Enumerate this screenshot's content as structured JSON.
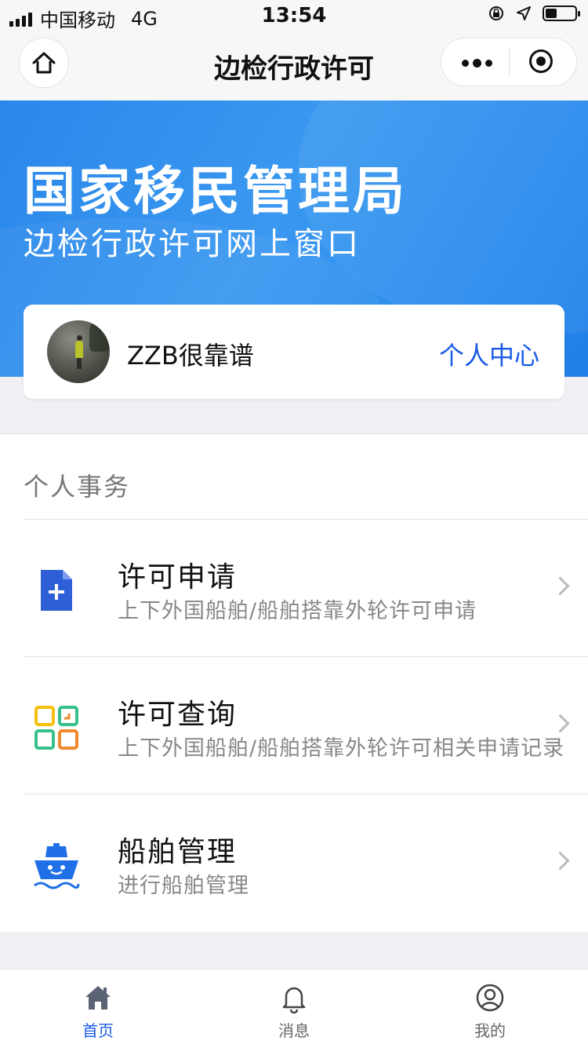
{
  "status_bar": {
    "carrier": "中国移动",
    "network": "4G",
    "time": "13:54"
  },
  "nav": {
    "title": "边检行政许可",
    "home_icon": "home-icon",
    "more_icon": "more-icon",
    "close_icon": "target-icon"
  },
  "banner": {
    "title": "国家移民管理局",
    "subtitle": "边检行政许可网上窗口"
  },
  "user": {
    "name": "ZZB很靠谱",
    "center_link": "个人中心"
  },
  "section": {
    "title": "个人事务",
    "items": [
      {
        "title": "许可申请",
        "desc": "上下外国船舶/船舶搭靠外轮许可申请",
        "icon": "add-document-icon"
      },
      {
        "title": "许可查询",
        "desc": "上下外国船舶/船舶搭靠外轮许可相关申请记录",
        "icon": "grid-query-icon"
      },
      {
        "title": "船舶管理",
        "desc": "进行船舶管理",
        "icon": "ship-icon"
      }
    ]
  },
  "tabbar": {
    "tabs": [
      {
        "label": "首页",
        "icon": "home-icon",
        "active": true
      },
      {
        "label": "消息",
        "icon": "bell-icon",
        "active": false
      },
      {
        "label": "我的",
        "icon": "user-icon",
        "active": false
      }
    ]
  },
  "colors": {
    "accent": "#1a5be6",
    "banner": "#2a87ea"
  }
}
